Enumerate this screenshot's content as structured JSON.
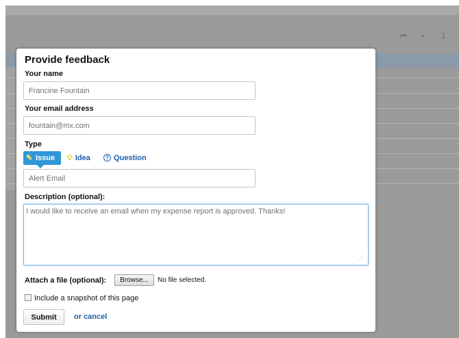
{
  "backdrop": {
    "pager": {
      "first": "⏮",
      "prev": "«",
      "page": "1"
    }
  },
  "dialog": {
    "title": "Provide feedback",
    "name": {
      "label": "Your name",
      "value": "Francine Fountain"
    },
    "email": {
      "label": "Your email address",
      "value": "fountain@mx.com"
    },
    "type": {
      "label": "Type",
      "options": [
        {
          "label": "Issue",
          "icon": "pencil-icon",
          "selected": true
        },
        {
          "label": "Idea",
          "icon": "lightbulb-icon",
          "selected": false
        },
        {
          "label": "Question",
          "icon": "question-icon",
          "selected": false
        }
      ]
    },
    "subject": {
      "value": "Alert Email"
    },
    "description": {
      "label": "Description (optional):",
      "value": "I would like to receive an email when my expense report is approved. Thanks!"
    },
    "attach": {
      "label": "Attach a file (optional):",
      "browse_label": "Browse...",
      "status": "No file selected."
    },
    "snapshot": {
      "label": "Include a snapshot of this page",
      "checked": false
    },
    "submit_label": "Submit",
    "or_text": "or",
    "cancel_label": "cancel"
  },
  "colors": {
    "accent": "#2f98d8",
    "link": "#1e5fa8",
    "backdrop": "#9a9a9a"
  }
}
